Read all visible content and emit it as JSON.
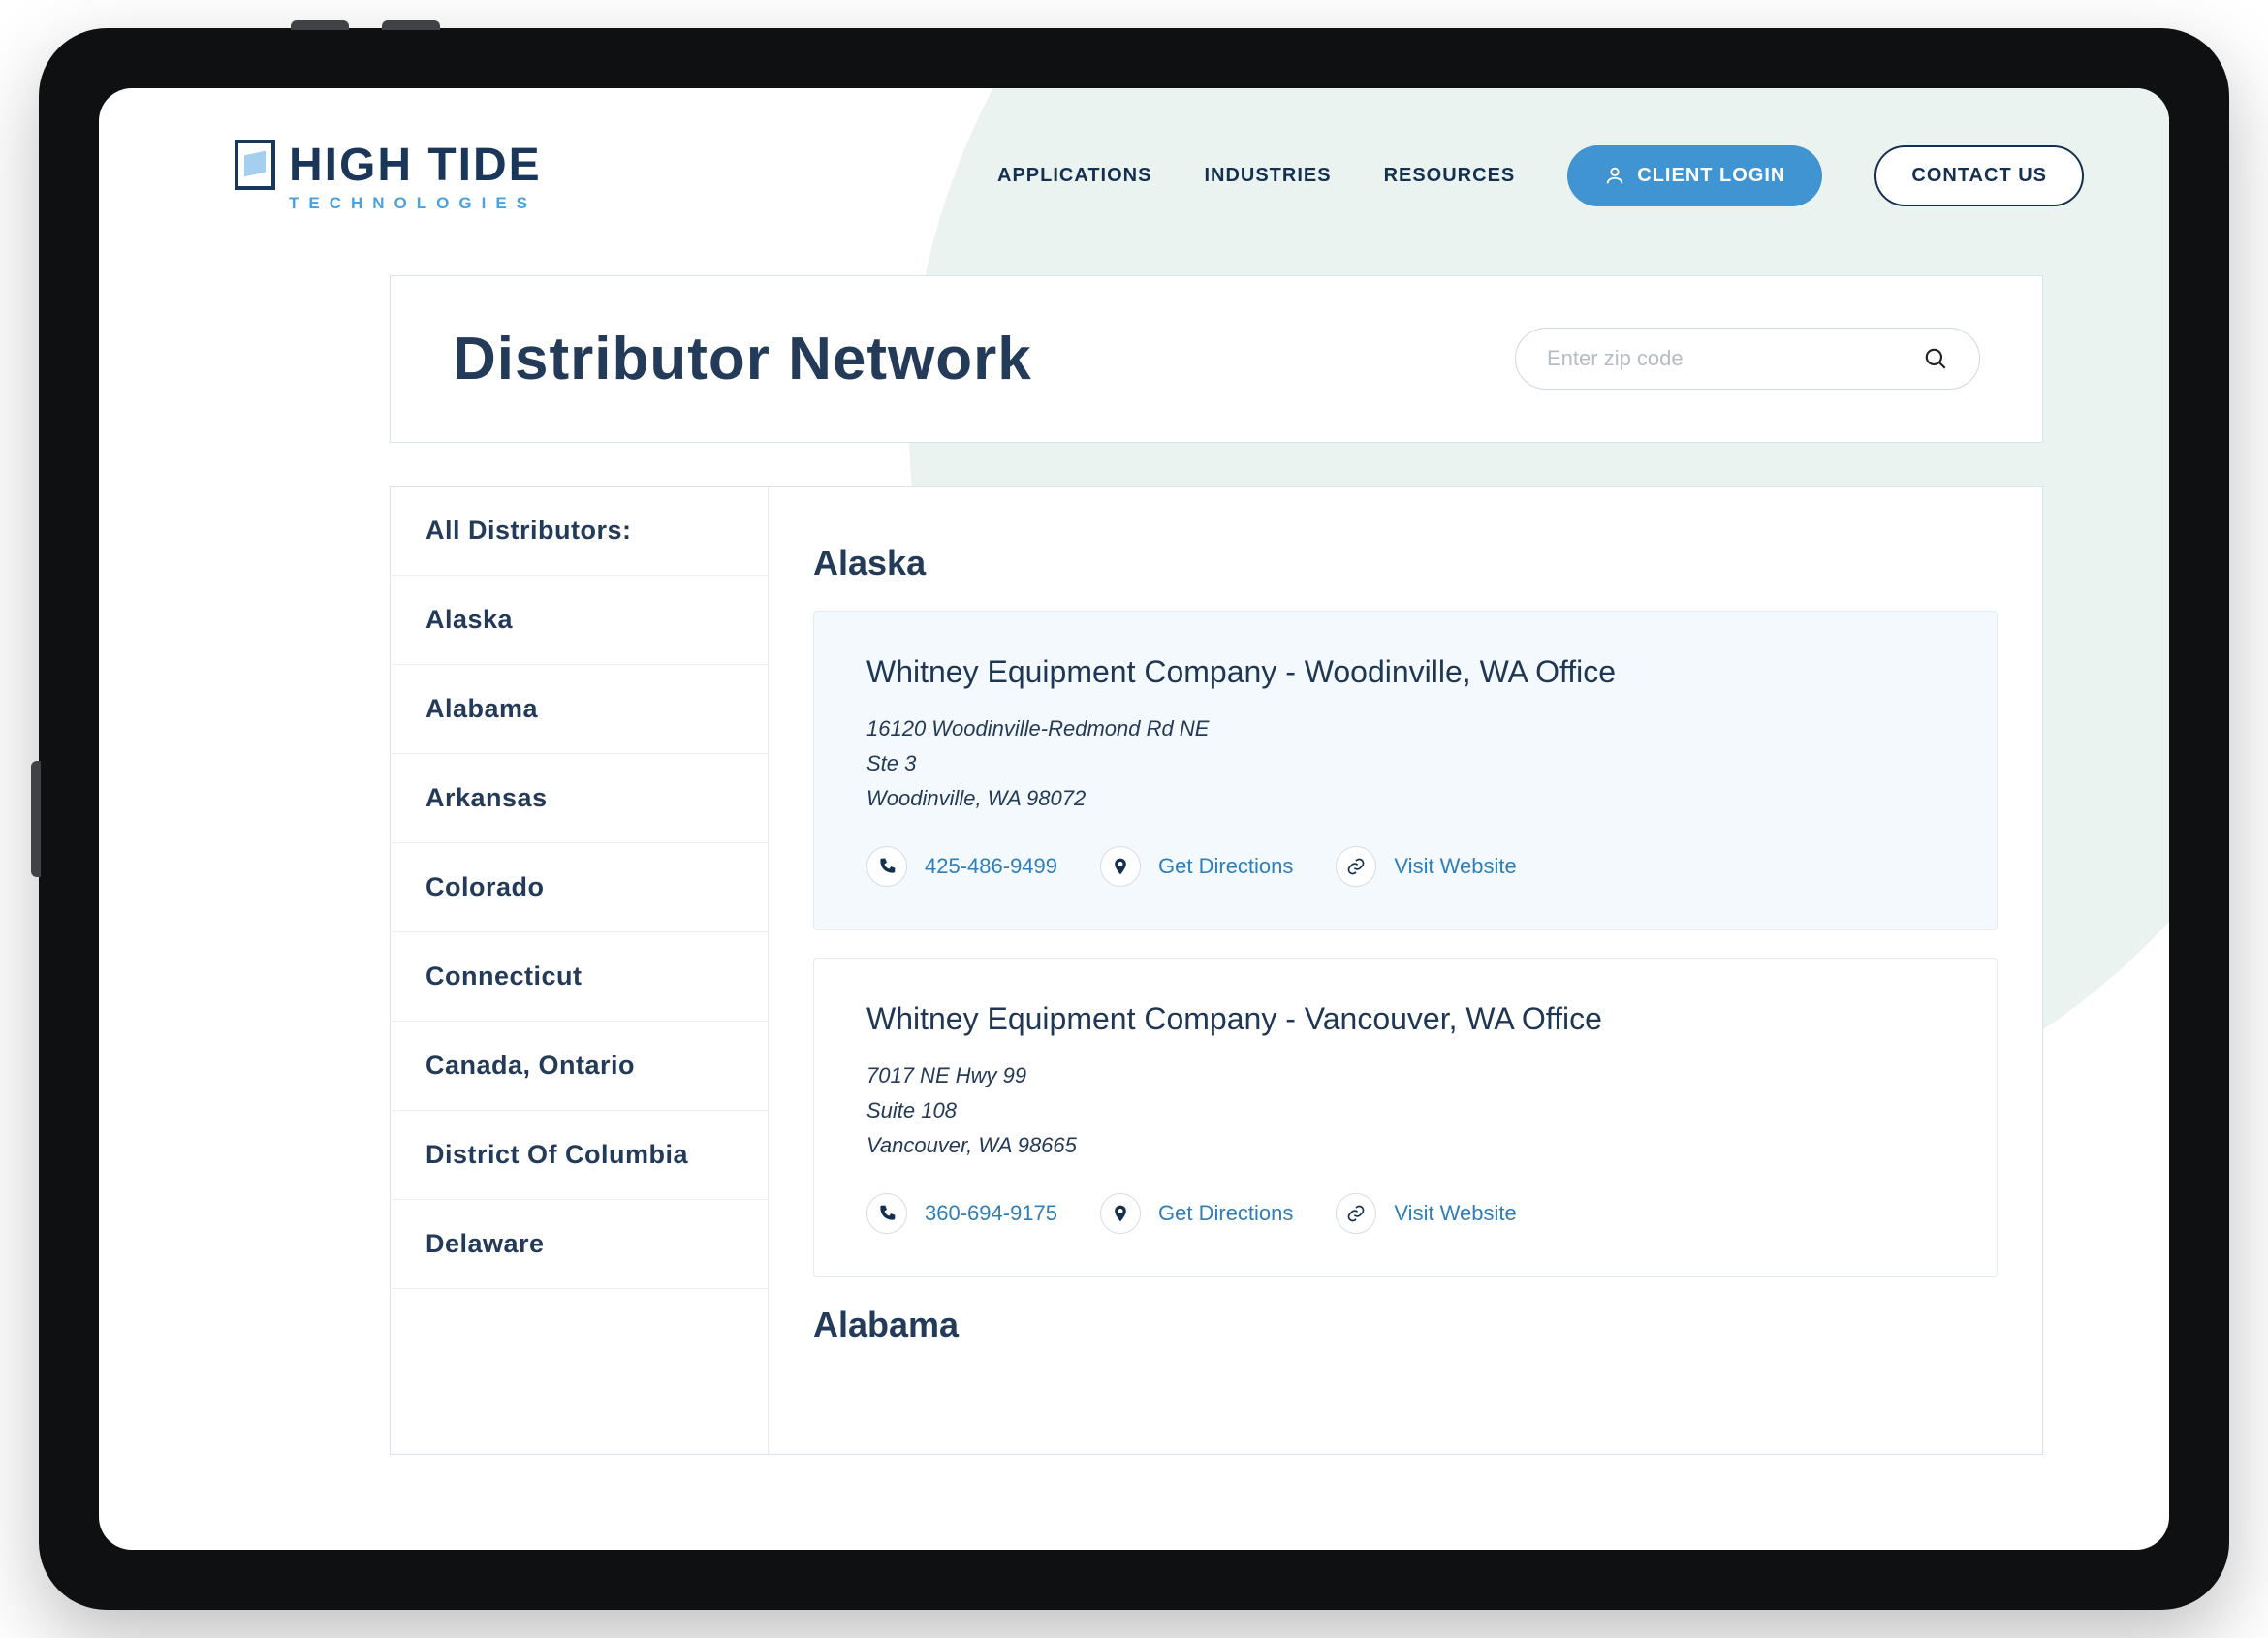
{
  "brand": {
    "name": "HIGH TIDE",
    "tagline": "TECHNOLOGIES"
  },
  "nav": {
    "links": [
      "APPLICATIONS",
      "INDUSTRIES",
      "RESOURCES"
    ],
    "client_login": "CLIENT LOGIN",
    "contact": "CONTACT US"
  },
  "header": {
    "title": "Distributor Network",
    "search_placeholder": "Enter zip code"
  },
  "sidebar": {
    "items": [
      "All Distributors:",
      "Alaska",
      "Alabama",
      "Arkansas",
      "Colorado",
      "Connecticut",
      "Canada, Ontario",
      "District Of Columbia",
      "Delaware"
    ]
  },
  "results": {
    "sections": [
      {
        "state": "Alaska",
        "distributors": [
          {
            "name": "Whitney Equipment Company - Woodinville, WA Office",
            "address_lines": [
              "16120 Woodinville-Redmond Rd NE",
              "Ste 3",
              "Woodinville, WA 98072"
            ],
            "phone": "425-486-9499",
            "directions_label": "Get Directions",
            "website_label": "Visit Website",
            "active": true
          },
          {
            "name": "Whitney Equipment Company - Vancouver, WA Office",
            "address_lines": [
              "7017 NE Hwy 99",
              "Suite 108",
              "Vancouver, WA 98665"
            ],
            "phone": "360-694-9175",
            "directions_label": "Get Directions",
            "website_label": "Visit Website",
            "active": false
          }
        ]
      },
      {
        "state": "Alabama",
        "distributors": []
      }
    ]
  }
}
